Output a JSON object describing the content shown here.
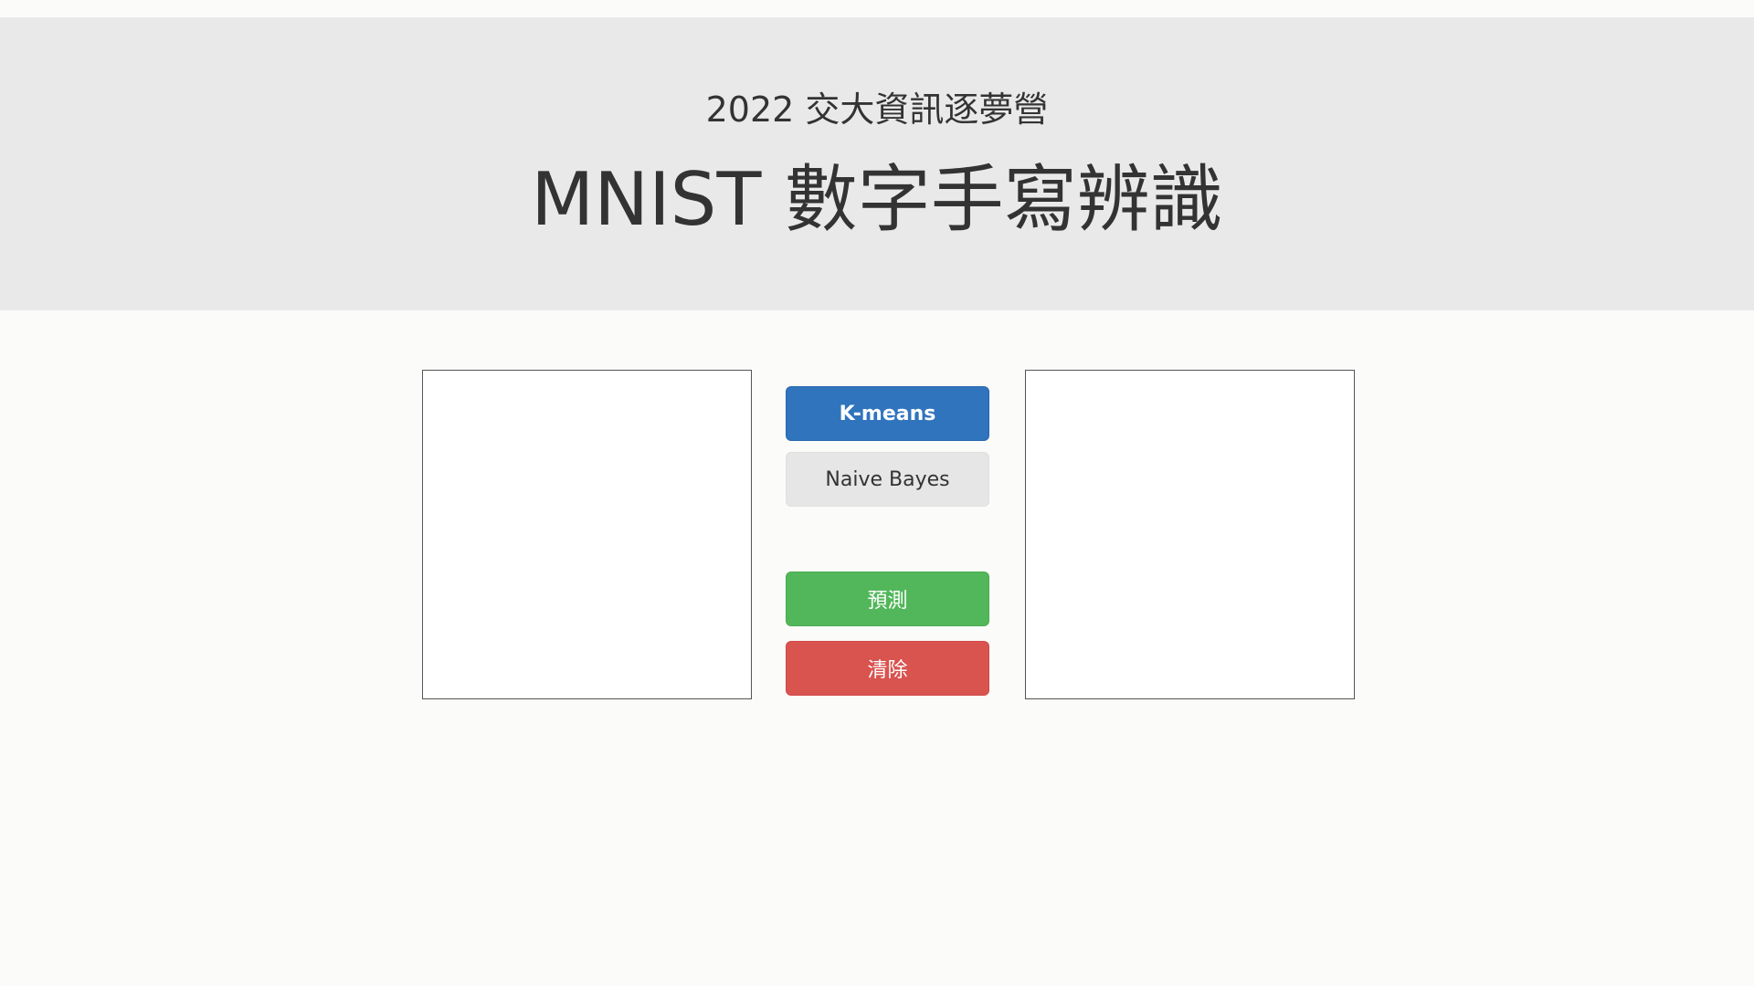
{
  "header": {
    "subtitle": "2022 交大資訊逐夢營",
    "title": "MNIST 數字手寫辨識"
  },
  "controls": {
    "kmeans_label": "K-means",
    "naive_bayes_label": "Naive Bayes",
    "predict_label": "預測",
    "clear_label": "清除"
  },
  "colors": {
    "header_bg": "#e9e9e9",
    "kmeans": "#2f74bd",
    "naive_bayes": "#e6e6e6",
    "predict": "#52b75a",
    "clear": "#d9534f"
  }
}
